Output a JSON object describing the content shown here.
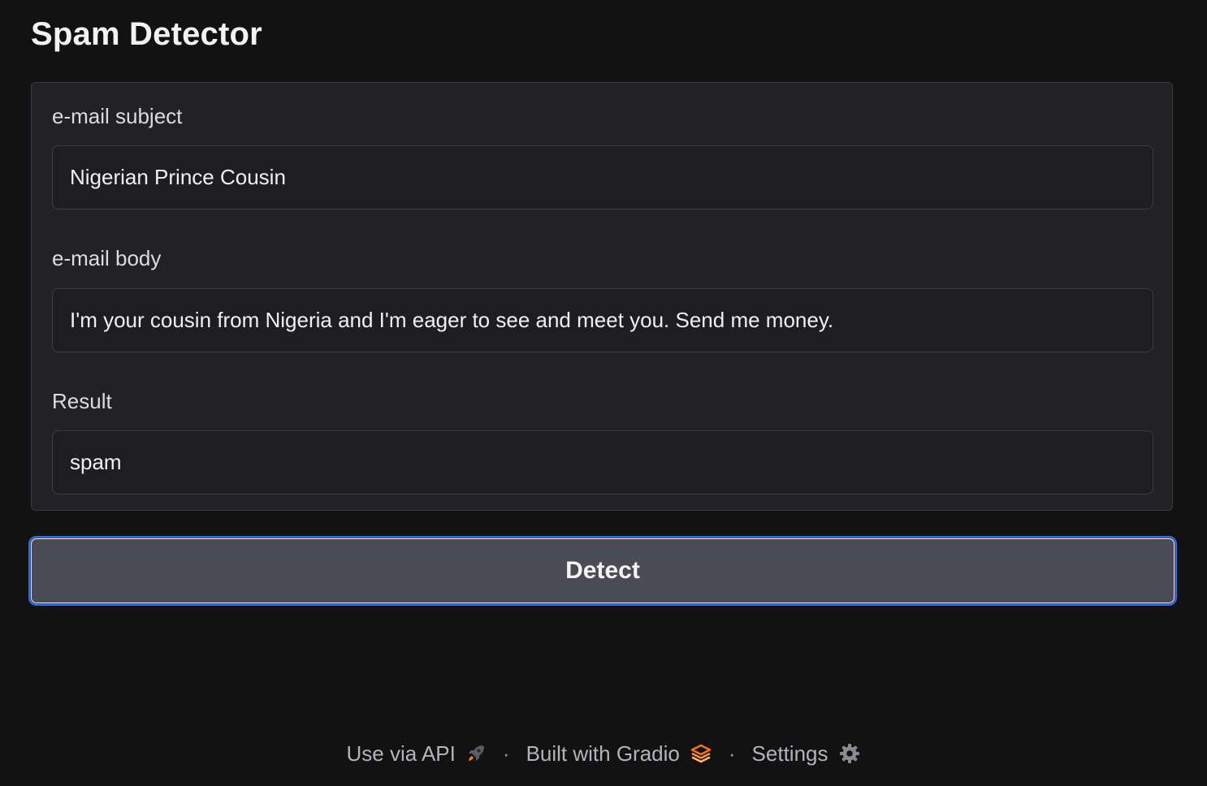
{
  "app": {
    "title": "Spam Detector"
  },
  "form": {
    "subject": {
      "label": "e-mail subject",
      "value": "Nigerian Prince Cousin"
    },
    "body": {
      "label": "e-mail body",
      "value": "I'm your cousin from Nigeria and I'm eager to see and meet you. Send me money."
    },
    "result": {
      "label": "Result",
      "value": "spam"
    }
  },
  "actions": {
    "detect_label": "Detect"
  },
  "footer": {
    "api_label": "Use via API",
    "api_icon": "rocket-icon",
    "separator": "·",
    "gradio_label": "Built with Gradio",
    "gradio_icon": "gradio-logo-icon",
    "settings_label": "Settings",
    "settings_icon": "gear-icon"
  },
  "colors": {
    "background": "#121213",
    "panel": "#222226",
    "button": "#4a4b55",
    "focus_border": "#2f6cf0",
    "accent_orange": "#f97316"
  }
}
